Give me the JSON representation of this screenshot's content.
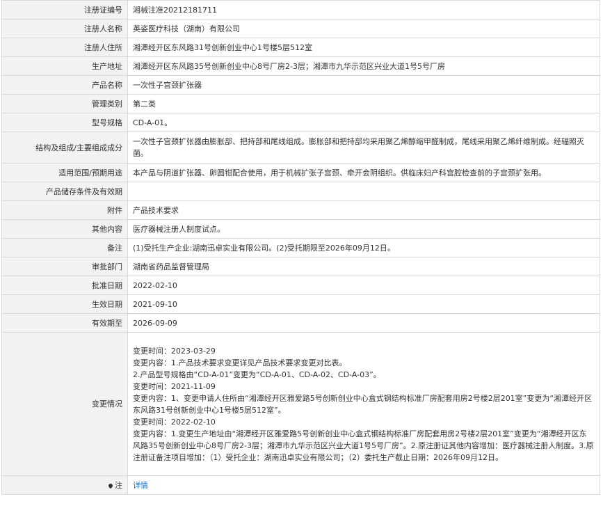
{
  "rows": [
    {
      "label": "注册证编号",
      "value": "湘械注准20212181711"
    },
    {
      "label": "注册人名称",
      "value": "英姿医疗科技（湖南）有限公司"
    },
    {
      "label": "注册人住所",
      "value": "湘潭经开区东风路31号创新创业中心1号楼5层512室"
    },
    {
      "label": "生产地址",
      "value": "湘潭经开区东风路35号创新创业中心8号厂房2-3层；湘潭市九华示范区兴业大道1号5号厂房"
    },
    {
      "label": "产品名称",
      "value": "一次性子宫颈扩张器"
    },
    {
      "label": "管理类别",
      "value": "第二类"
    },
    {
      "label": "型号规格",
      "value": "CD-A-01。"
    },
    {
      "label": "结构及组成/主要组成成分",
      "value": "一次性子宫颈扩张器由膨胀部、把持部和尾线组成。膨胀部和把持部均采用聚乙烯醇缩甲醛制成，尾线采用聚乙烯纤维制成。经辐照灭菌。"
    },
    {
      "label": "适用范围/预期用途",
      "value": "本产品与阴道扩张器、卵圆钳配合使用，用于机械扩张子宫颈、牵开会阴组织。供临床妇产科宫腔检查前的子宫颈扩张用。"
    },
    {
      "label": "产品储存条件及有效期",
      "value": ""
    },
    {
      "label": "附件",
      "value": "产品技术要求"
    },
    {
      "label": "其他内容",
      "value": "医疗器械注册人制度试点。"
    },
    {
      "label": "备注",
      "value": "(1)受托生产企业:湖南迅卓实业有限公司。(2)受托期限至2026年09月12日。"
    },
    {
      "label": "审批部门",
      "value": "湖南省药品监督管理局"
    },
    {
      "label": "批准日期",
      "value": "2022-02-10"
    },
    {
      "label": "生效日期",
      "value": "2021-09-10"
    },
    {
      "label": "有效期至",
      "value": "2026-09-09"
    }
  ],
  "changes": {
    "label": "变更情况",
    "lines": [
      "变更时间：2023-03-29",
      "变更内容：1.产品技术要求变更详见产品技术要求变更对比表。",
      "2.产品型号规格由“CD-A-01”变更为“CD-A-01、CD-A-02、CD-A-03”。",
      "变更时间：2021-11-09",
      "变更内容：1、变更申请人住所由“湘潭经开区雅爱路5号创新创业中心盒式钢结构标准厂房配套用房2号楼2层201室”变更为“湘潭经开区东风路31号创新创业中心1号楼5层512室”。",
      "变更时间：2022-02-10",
      "变更内容：1.变更生产地址由“湘潭经开区雅爱路5号创新创业中心盒式钢结构标准厂房配套用房2号楼2层201室”变更为“湘潭经开区东风路35号创新创业中心8号厂房2-3层；湘潭市九华示范区兴业大道1号5号厂房”。2.原注册证其他内容增加：医疗器械注册人制度。3.原注册证备注项目增加：（1）受托企业：湖南迅卓实业有限公司；（2）委托生产截止日期：2026年09月12日。"
    ]
  },
  "note": {
    "label": "注",
    "link": "详情"
  }
}
